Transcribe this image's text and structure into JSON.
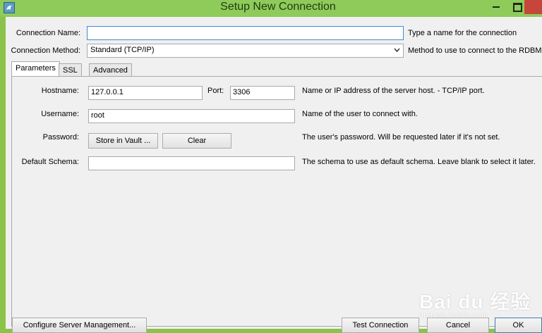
{
  "window": {
    "title": "Setup New Connection",
    "icon": "dolphin-icon"
  },
  "form": {
    "connection_name_label": "Connection Name:",
    "connection_name_value": "",
    "connection_name_hint": "Type a name for the connection",
    "connection_method_label": "Connection Method:",
    "connection_method_value": "Standard (TCP/IP)",
    "connection_method_hint": "Method to use to connect to the RDBMS"
  },
  "tabs": [
    {
      "label": "Parameters",
      "active": true
    },
    {
      "label": "SSL",
      "active": false
    },
    {
      "label": "Advanced",
      "active": false
    }
  ],
  "parameters": {
    "hostname_label": "Hostname:",
    "hostname_value": "127.0.0.1",
    "port_label": "Port:",
    "port_value": "3306",
    "hostname_hint": "Name or IP address of the server host. - TCP/IP port.",
    "username_label": "Username:",
    "username_value": "root",
    "username_hint": "Name of the user to connect with.",
    "password_label": "Password:",
    "store_vault_label": "Store in Vault ...",
    "clear_label": "Clear",
    "password_hint": "The user's password. Will be requested later if it's not set.",
    "schema_label": "Default Schema:",
    "schema_value": "",
    "schema_hint": "The schema to use as default schema. Leave blank to select it later."
  },
  "footer": {
    "configure_label": "Configure Server Management...",
    "test_label": "Test Connection",
    "cancel_label": "Cancel",
    "ok_label": "OK"
  },
  "watermark": {
    "brand": "Bai du 经验",
    "url": "jingyan.baidu.com"
  },
  "colors": {
    "titlebar": "#8fcb5a",
    "close_button": "#c7463c",
    "focus_border": "#3d8ad6"
  }
}
